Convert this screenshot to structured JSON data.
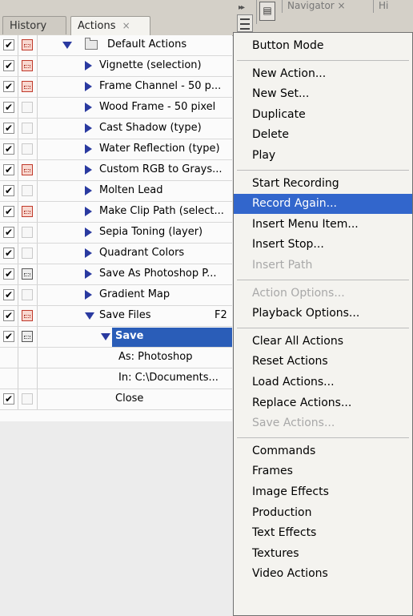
{
  "tabs": [
    {
      "label": "History",
      "active": false
    },
    {
      "label": "Actions",
      "active": true,
      "close": "×"
    }
  ],
  "other_panel": {
    "tab1": "Navigator",
    "close": "×",
    "tab2": "Hi"
  },
  "actions": [
    {
      "label": "Default Actions",
      "check": "✔",
      "dialog": "red",
      "expand": "down",
      "folder": true,
      "indent": 0
    },
    {
      "label": "Vignette (selection)",
      "check": "✔",
      "dialog": "red",
      "expand": "right",
      "indent": 1
    },
    {
      "label": "Frame Channel - 50 p...",
      "check": "✔",
      "dialog": "red",
      "expand": "right",
      "indent": 1
    },
    {
      "label": "Wood Frame - 50 pixel",
      "check": "✔",
      "dialog": "blank",
      "expand": "right",
      "indent": 1
    },
    {
      "label": "Cast Shadow (type)",
      "check": "✔",
      "dialog": "blank",
      "expand": "right",
      "indent": 1
    },
    {
      "label": "Water Reflection (type)",
      "check": "✔",
      "dialog": "blank",
      "expand": "right",
      "indent": 1
    },
    {
      "label": "Custom RGB to Grays...",
      "check": "✔",
      "dialog": "red",
      "expand": "right",
      "indent": 1
    },
    {
      "label": "Molten Lead",
      "check": "✔",
      "dialog": "blank",
      "expand": "right",
      "indent": 1
    },
    {
      "label": "Make Clip Path (select...",
      "check": "✔",
      "dialog": "red",
      "expand": "right",
      "indent": 1
    },
    {
      "label": "Sepia Toning (layer)",
      "check": "✔",
      "dialog": "blank",
      "expand": "right",
      "indent": 1
    },
    {
      "label": "Quadrant Colors",
      "check": "✔",
      "dialog": "blank",
      "expand": "right",
      "indent": 1
    },
    {
      "label": "Save As Photoshop P...",
      "check": "✔",
      "dialog": "gray",
      "expand": "right",
      "indent": 1
    },
    {
      "label": "Gradient Map",
      "check": "✔",
      "dialog": "blank",
      "expand": "right",
      "indent": 1
    },
    {
      "label": "Save Files",
      "check": "✔",
      "dialog": "red",
      "expand": "down",
      "indent": 1,
      "shortcut": "F2"
    },
    {
      "label": "Save",
      "check": "✔",
      "dialog": "gray",
      "expand": "down",
      "indent": 2,
      "selected": true
    },
    {
      "label": "As: Photoshop",
      "check": "",
      "dialog": "none",
      "expand": "none",
      "indent": 3
    },
    {
      "label": "In: C:\\Documents...",
      "check": "",
      "dialog": "none",
      "expand": "none",
      "indent": 3
    },
    {
      "label": "Close",
      "check": "✔",
      "dialog": "blank",
      "expand": "none",
      "indent": 2
    }
  ],
  "menu": [
    {
      "label": "Button Mode",
      "state": "normal"
    },
    {
      "sep": true
    },
    {
      "label": "New Action...",
      "state": "normal"
    },
    {
      "label": "New Set...",
      "state": "normal"
    },
    {
      "label": "Duplicate",
      "state": "normal"
    },
    {
      "label": "Delete",
      "state": "normal"
    },
    {
      "label": "Play",
      "state": "normal"
    },
    {
      "sep": true
    },
    {
      "label": "Start Recording",
      "state": "normal"
    },
    {
      "label": "Record Again...",
      "state": "highlighted"
    },
    {
      "label": "Insert Menu Item...",
      "state": "normal"
    },
    {
      "label": "Insert Stop...",
      "state": "normal"
    },
    {
      "label": "Insert Path",
      "state": "disabled"
    },
    {
      "sep": true
    },
    {
      "label": "Action Options...",
      "state": "disabled"
    },
    {
      "label": "Playback Options...",
      "state": "normal"
    },
    {
      "sep": true
    },
    {
      "label": "Clear All Actions",
      "state": "normal"
    },
    {
      "label": "Reset Actions",
      "state": "normal"
    },
    {
      "label": "Load Actions...",
      "state": "normal"
    },
    {
      "label": "Replace Actions...",
      "state": "normal"
    },
    {
      "label": "Save Actions...",
      "state": "disabled"
    },
    {
      "sep": true
    },
    {
      "label": "Commands",
      "state": "normal"
    },
    {
      "label": "Frames",
      "state": "normal"
    },
    {
      "label": "Image Effects",
      "state": "normal"
    },
    {
      "label": "Production",
      "state": "normal"
    },
    {
      "label": "Text Effects",
      "state": "normal"
    },
    {
      "label": "Textures",
      "state": "normal"
    },
    {
      "label": "Video Actions",
      "state": "normal"
    }
  ],
  "colors": {
    "highlight": "#3266cc",
    "selection": "#2a5db8",
    "expand_arrow": "#2a3aa0"
  }
}
